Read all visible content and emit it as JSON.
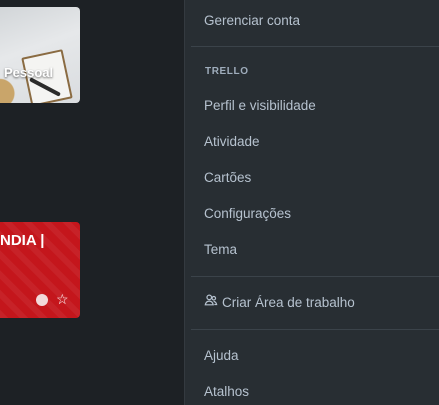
{
  "boards": {
    "personal_title": "Pessoal",
    "red_title": "NDIA |",
    "star_glyph": "☆"
  },
  "menu": {
    "manage_account": "Gerenciar conta",
    "section_trello": "TRELLO",
    "items": [
      {
        "label": "Perfil e visibilidade"
      },
      {
        "label": "Atividade"
      },
      {
        "label": "Cartões"
      },
      {
        "label": "Configurações"
      },
      {
        "label": "Tema"
      }
    ],
    "create_workspace": "Criar Área de trabalho",
    "help": "Ajuda",
    "shortcuts": "Atalhos"
  },
  "colors": {
    "background": "#1d2125",
    "menu_bg": "#282e33",
    "menu_text": "#b6c2cf",
    "red_board": "#c4161c"
  },
  "icons": {
    "create_workspace": "people-icon",
    "star": "star-icon"
  }
}
